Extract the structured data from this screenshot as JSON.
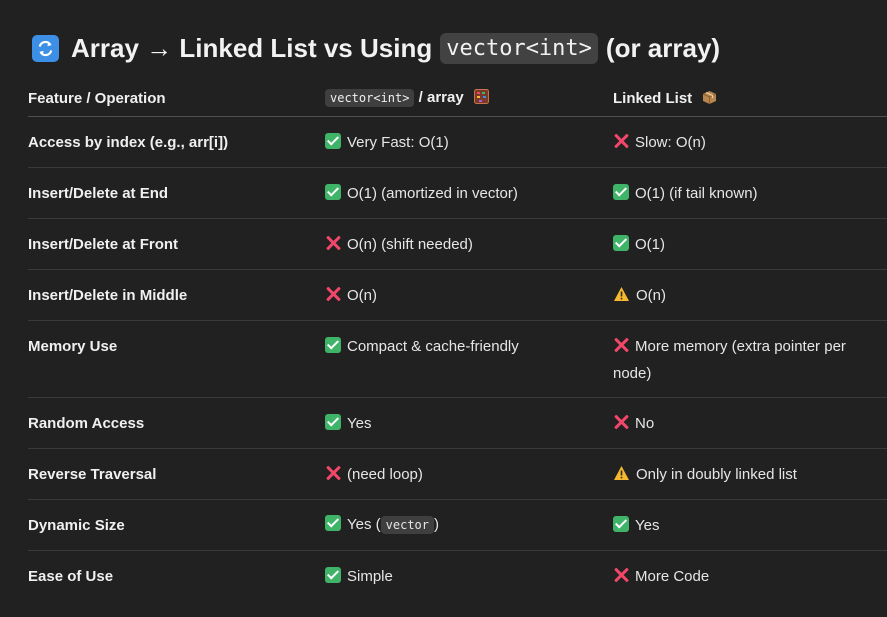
{
  "title": {
    "text_before": "Array → Linked List vs Using",
    "code": "vector<int>",
    "text_after": "(or array)"
  },
  "header": {
    "feature": "Feature / Operation",
    "array_code": "vector<int>",
    "array_suffix": "/ array",
    "linked": "Linked List"
  },
  "rows": [
    {
      "feature": "Access by index (e.g., arr[i])",
      "array_text": "Very Fast: O(1)",
      "linked_text": "Slow: O(n)"
    },
    {
      "feature": "Insert/Delete at End",
      "array_text": "O(1) (amortized in vector)",
      "linked_text": "O(1) (if tail known)"
    },
    {
      "feature": "Insert/Delete at Front",
      "array_text": "O(n) (shift needed)",
      "linked_text": "O(1)"
    },
    {
      "feature": "Insert/Delete in Middle",
      "array_text": "O(n)",
      "linked_text": "O(n)"
    },
    {
      "feature": "Memory Use",
      "array_text": "Compact & cache-friendly",
      "linked_text": "More memory (extra pointer per node)"
    },
    {
      "feature": "Random Access",
      "array_text": "Yes",
      "linked_text": "No"
    },
    {
      "feature": "Reverse Traversal",
      "array_text": "(need loop)",
      "linked_text": "Only in doubly linked list"
    },
    {
      "feature": "Dynamic Size",
      "array_pre": "Yes (",
      "array_code": "vector",
      "array_post": ")",
      "linked_text": "Yes"
    },
    {
      "feature": "Ease of Use",
      "array_text": "Simple",
      "linked_text": "More Code"
    }
  ],
  "colors": {
    "background": "#212121",
    "check": "#3fb468",
    "cross": "#f0476a",
    "warning": "#f5b82e",
    "title_icon": "#3d8fe6"
  }
}
